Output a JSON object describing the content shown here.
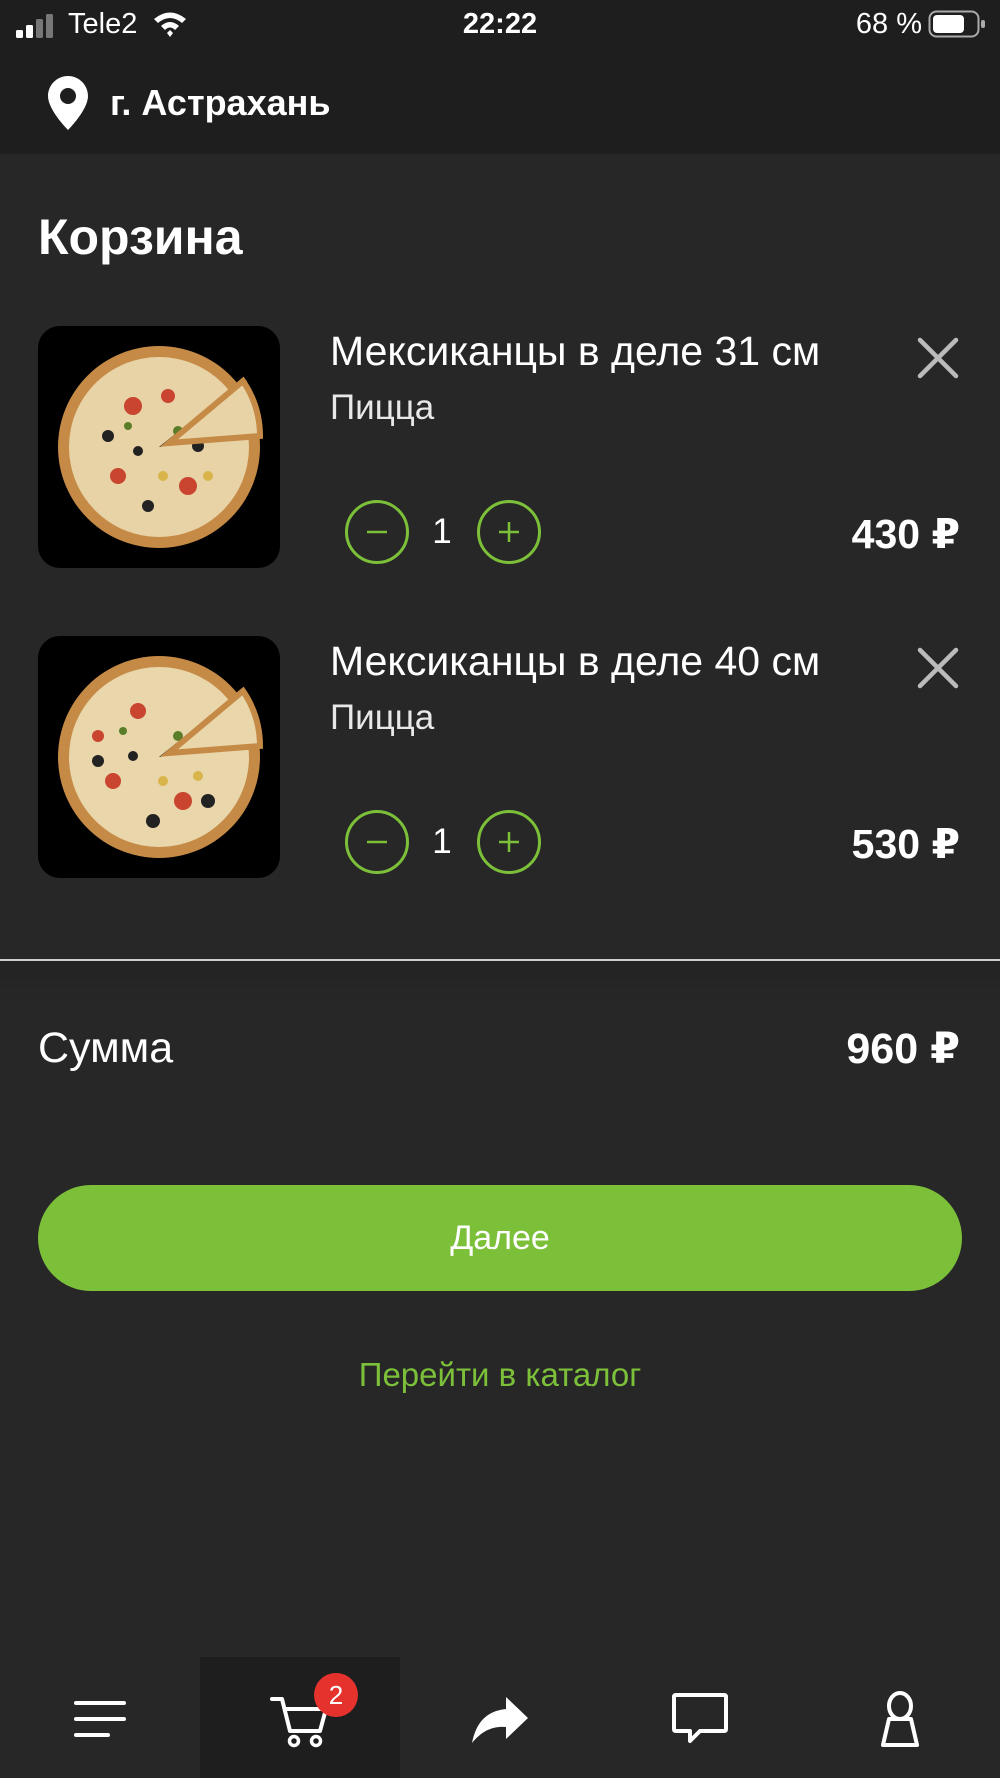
{
  "status_bar": {
    "carrier": "Tele2",
    "time": "22:22",
    "battery": "68 %"
  },
  "location": {
    "city": "г. Астрахань",
    "icon": "map-pin-icon"
  },
  "page_title": "Корзина",
  "cart": {
    "items": [
      {
        "name": "Мексиканцы в деле 31 см",
        "category": "Пицца",
        "quantity": "1",
        "price": "430 ₽"
      },
      {
        "name": "Мексиканцы в деле 40 см",
        "category": "Пицца",
        "quantity": "1",
        "price": "530 ₽"
      }
    ]
  },
  "summary": {
    "label": "Сумма",
    "total": "960 ₽"
  },
  "actions": {
    "next_label": "Далее",
    "catalog_link": "Перейти в каталог"
  },
  "tab_bar": {
    "items": [
      {
        "icon": "menu-icon"
      },
      {
        "icon": "cart-icon",
        "badge": "2",
        "active": true
      },
      {
        "icon": "share-icon"
      },
      {
        "icon": "chat-icon"
      },
      {
        "icon": "profile-icon"
      }
    ]
  },
  "colors": {
    "accent": "#7cc03a",
    "background": "#272727",
    "header": "#1e1e1e",
    "badge": "#e5322d"
  }
}
